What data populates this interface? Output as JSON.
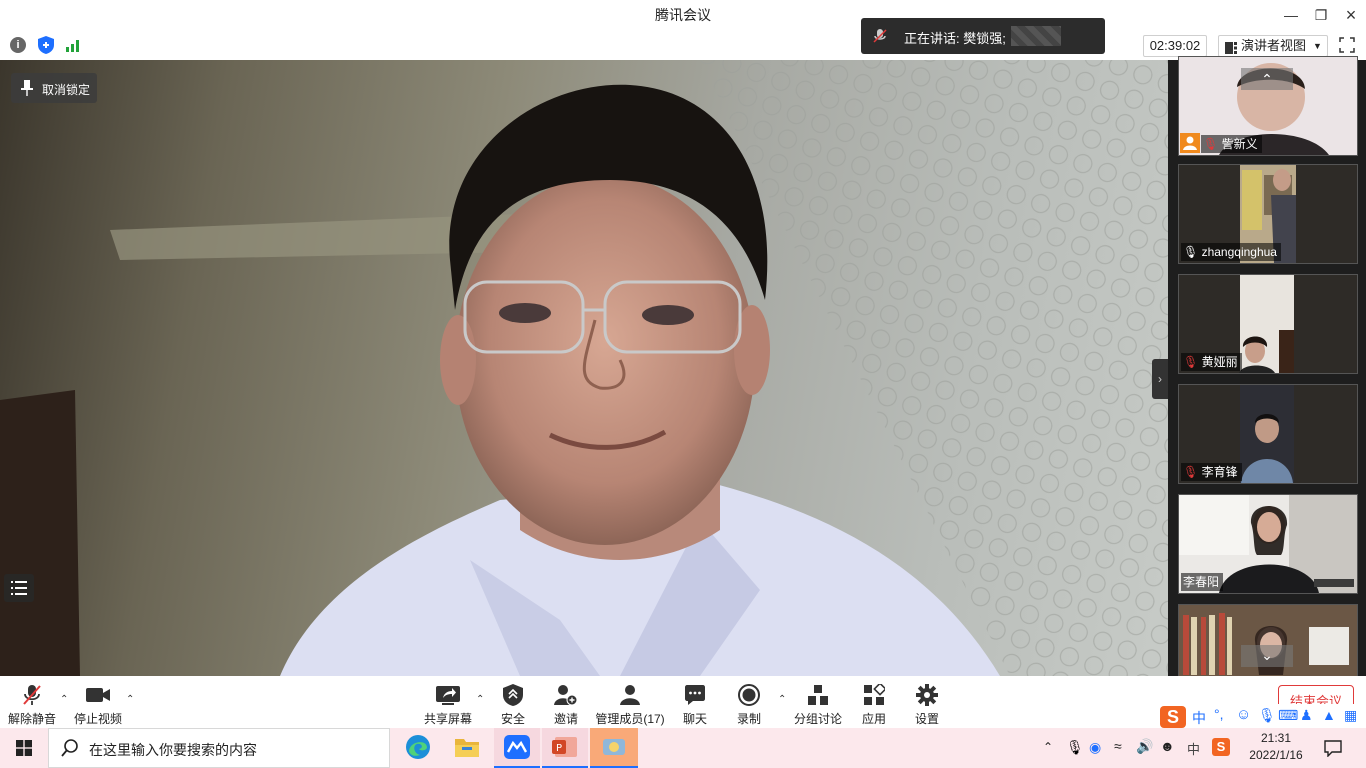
{
  "window": {
    "title": "腾讯会议"
  },
  "notice": {
    "speaking": "正在讲话: 樊锁强;"
  },
  "meeting": {
    "duration": "02:39:02",
    "view_mode": "演讲者视图"
  },
  "main_video": {
    "unpin_label": "取消锁定"
  },
  "participants": [
    {
      "name": "訾新义",
      "mic": "muted"
    },
    {
      "name": "zhangqinghua",
      "mic": "on"
    },
    {
      "name": "黄娅丽",
      "mic": "muted"
    },
    {
      "name": "李育锋",
      "mic": "muted"
    },
    {
      "name": "李春阳",
      "mic": "none"
    }
  ],
  "toolbar": {
    "unmute": "解除静音",
    "stop_video": "停止视频",
    "share_screen": "共享屏幕",
    "security": "安全",
    "invite": "邀请",
    "manage_members": "管理成员(17)",
    "chat": "聊天",
    "record": "录制",
    "breakout": "分组讨论",
    "apps": "应用",
    "settings": "设置",
    "end_meeting": "结束会议"
  },
  "taskbar": {
    "search_placeholder": "在这里输入你要搜索的内容",
    "ime_label": "中",
    "time": "21:31",
    "date": "2022/1/16"
  },
  "colors": {
    "accent": "#1e6fff",
    "record_red": "#e03a3a",
    "taskbar_bg": "#fce8ec"
  }
}
